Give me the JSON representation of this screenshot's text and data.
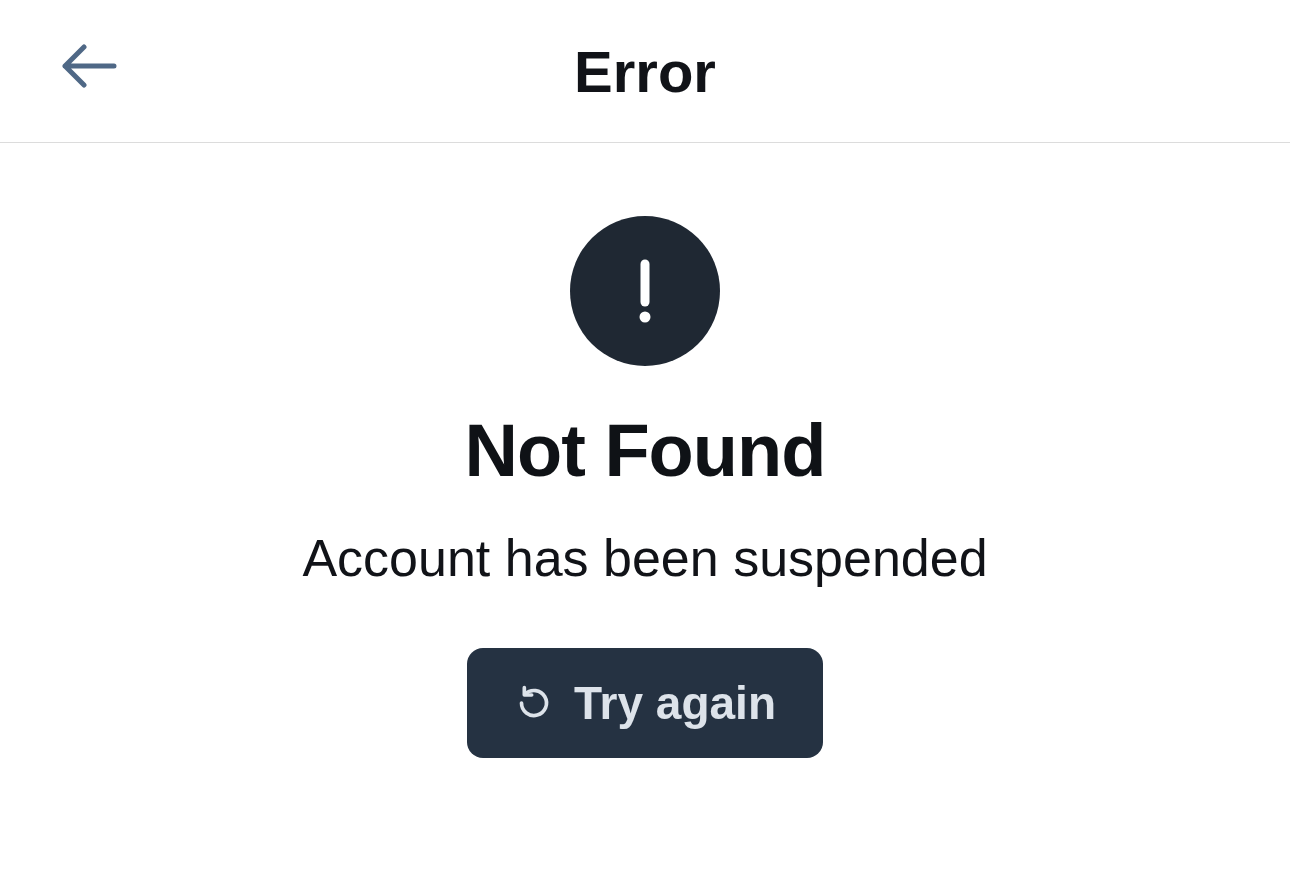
{
  "header": {
    "title": "Error"
  },
  "error": {
    "title": "Not Found",
    "message": "Account has been suspended"
  },
  "button": {
    "label": "Try again"
  }
}
